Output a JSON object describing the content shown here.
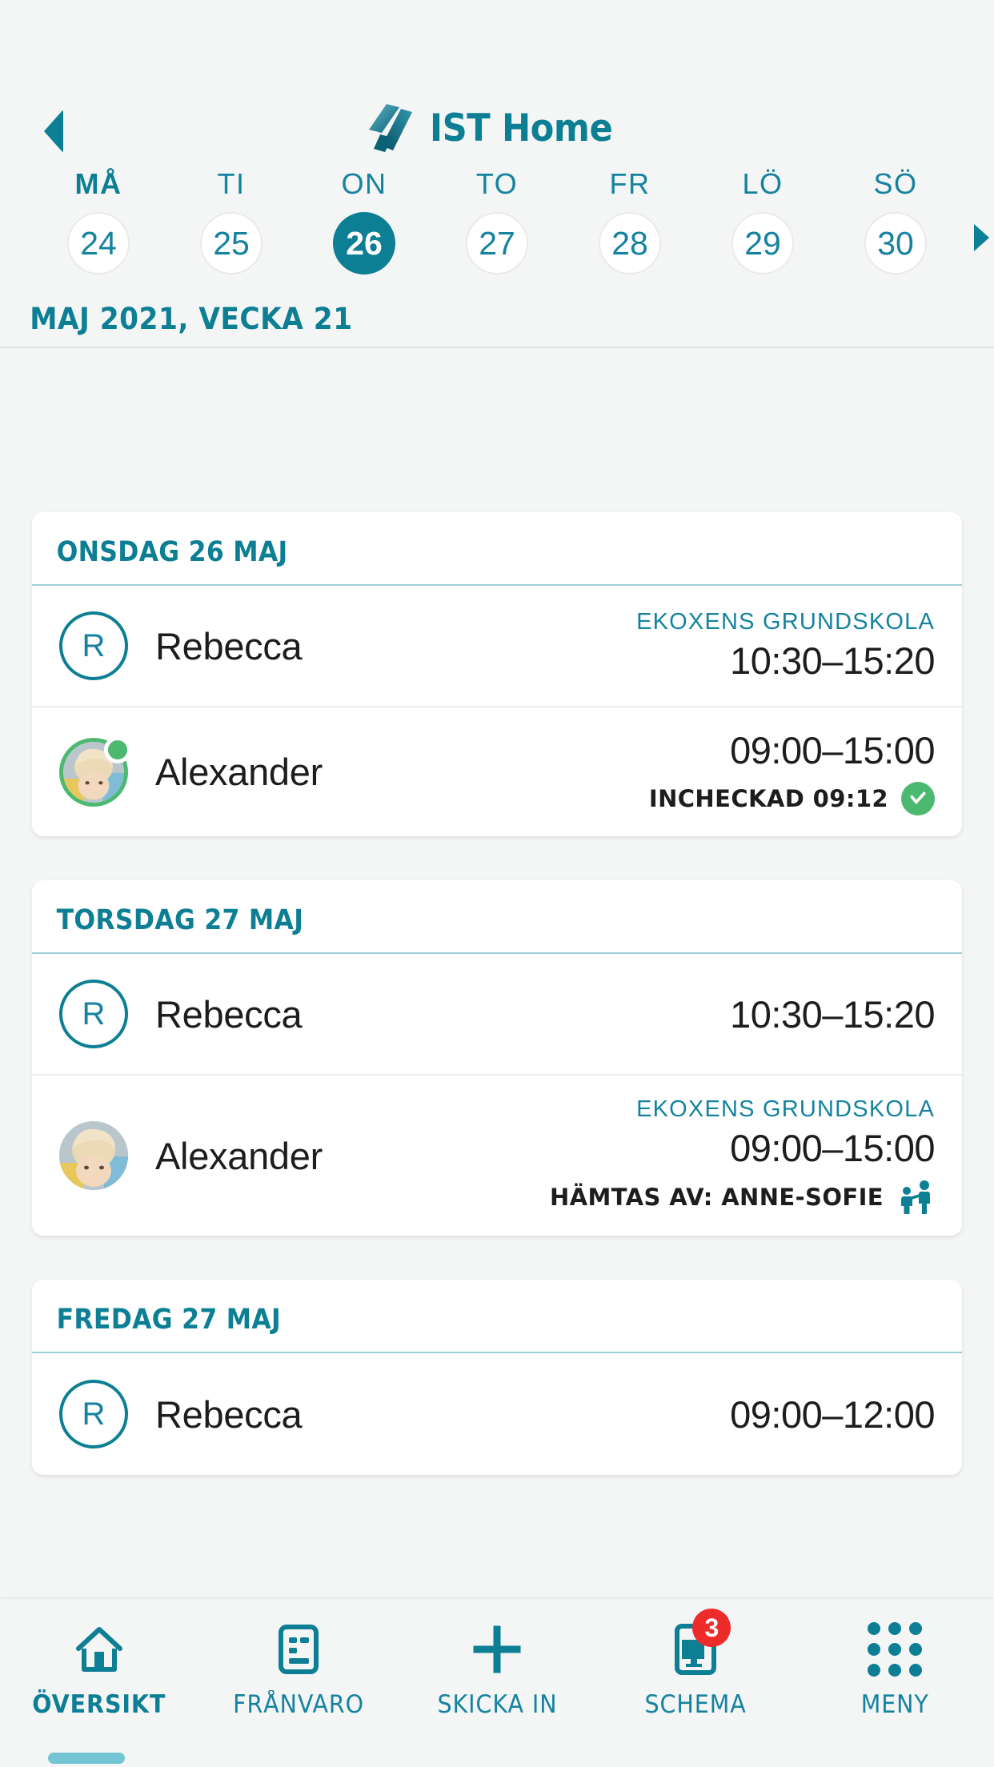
{
  "header": {
    "back_icon": "back-triangle-icon",
    "brand_mark": "ist-logo-mark",
    "brand_text": "IST Home"
  },
  "week": {
    "days": [
      {
        "name": "MÅ",
        "num": "24",
        "selected": false
      },
      {
        "name": "TI",
        "num": "25",
        "selected": false
      },
      {
        "name": "ON",
        "num": "26",
        "selected": true
      },
      {
        "name": "TO",
        "num": "27",
        "selected": false
      },
      {
        "name": "FR",
        "num": "28",
        "selected": false
      },
      {
        "name": "LÖ",
        "num": "29",
        "selected": false
      },
      {
        "name": "SÖ",
        "num": "30",
        "selected": false
      }
    ],
    "bold_dayname_index": 0,
    "month_line": "MAJ 2021, VECKA 21",
    "next_arrow": "next-week-arrow-icon"
  },
  "cards": [
    {
      "title": "ONSDAG 26 MAJ",
      "rows": [
        {
          "avatar_type": "initial",
          "initial": "R",
          "name": "Rebecca",
          "school": "EKOXENS GRUNDSKOLA",
          "time": "10:30–15:20",
          "status_text": "",
          "status_icon": ""
        },
        {
          "avatar_type": "photo",
          "initial": "",
          "name": "Alexander",
          "school": "",
          "time": "09:00–15:00",
          "status_text": "INCHECKAD 09:12",
          "status_icon": "check-circle-icon",
          "presence": true
        }
      ]
    },
    {
      "title": "TORSDAG 27 MAJ",
      "rows": [
        {
          "avatar_type": "initial",
          "initial": "R",
          "name": "Rebecca",
          "school": "",
          "time": "10:30–15:20",
          "status_text": "",
          "status_icon": ""
        },
        {
          "avatar_type": "photo",
          "initial": "",
          "name": "Alexander",
          "school": "EKOXENS GRUNDSKOLA",
          "time": "09:00–15:00",
          "status_text": "HÄMTAS AV: ANNE-SOFIE",
          "status_icon": "pickup-person-icon",
          "presence": false
        }
      ]
    },
    {
      "title": "FREDAG 27 MAJ",
      "rows": [
        {
          "avatar_type": "initial",
          "initial": "R",
          "name": "Rebecca",
          "school": "",
          "time": "09:00–12:00",
          "status_text": "",
          "status_icon": ""
        }
      ]
    }
  ],
  "bottom_nav": {
    "items": [
      {
        "label": "ÖVERSIKT",
        "icon": "home-icon",
        "active": true,
        "badge": ""
      },
      {
        "label": "FRÅNVARO",
        "icon": "document-lines-icon",
        "active": false,
        "badge": ""
      },
      {
        "label": "SKICKA IN",
        "icon": "plus-icon",
        "active": false,
        "badge": ""
      },
      {
        "label": "SCHEMA",
        "icon": "schedule-screen-icon",
        "active": false,
        "badge": "3"
      },
      {
        "label": "MENY",
        "icon": "grid-dots-icon",
        "active": false,
        "badge": ""
      }
    ]
  },
  "colors": {
    "brand_teal": "#0d7f94",
    "accent_teal": "#1583a0",
    "green": "#4cb971",
    "badge_red": "#ee2b2b",
    "page_bg": "#f4f5f5"
  }
}
